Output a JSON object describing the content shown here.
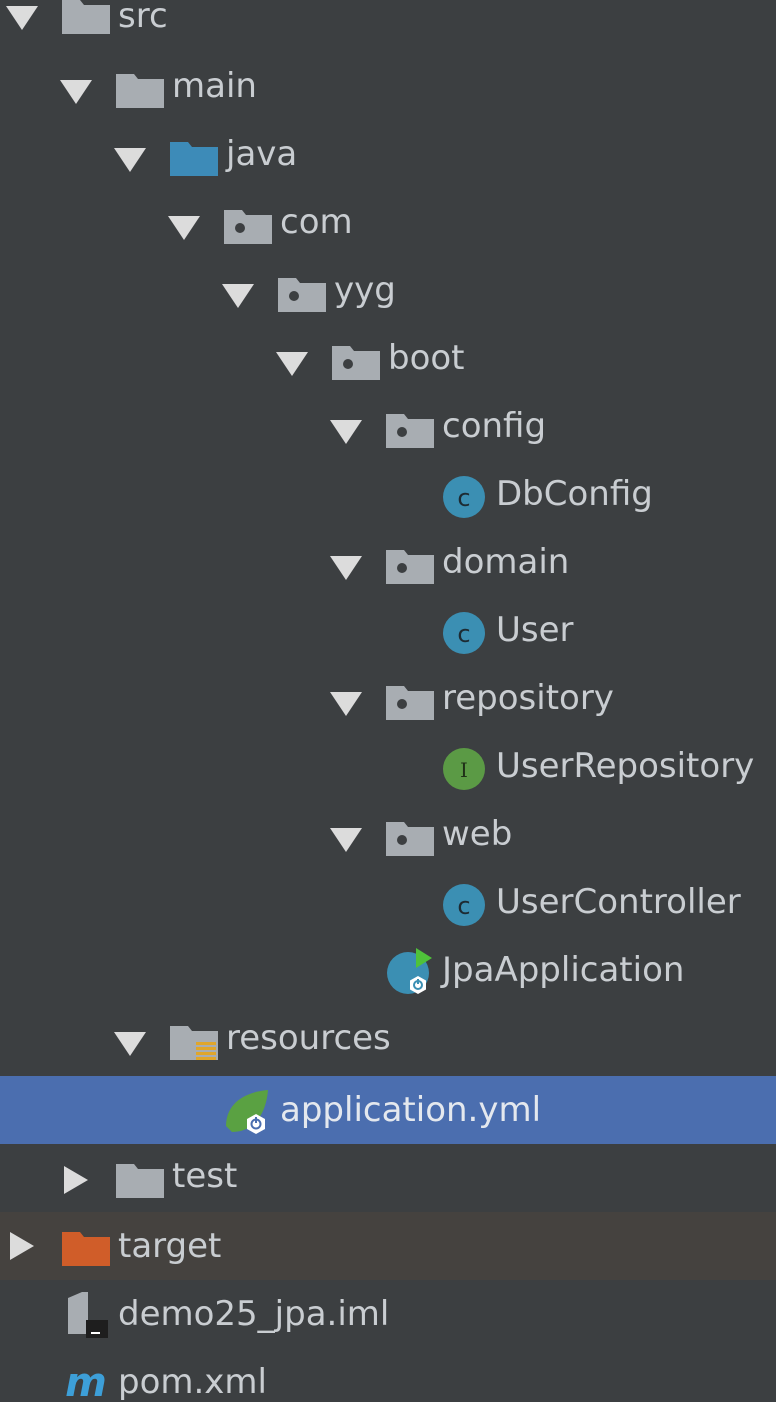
{
  "project_tree": {
    "items": [
      {
        "label": "src",
        "icon": "folder-icon",
        "expanded": true
      },
      {
        "label": "main",
        "icon": "folder-icon",
        "expanded": true
      },
      {
        "label": "java",
        "icon": "source-root-folder-icon",
        "expanded": true
      },
      {
        "label": "com",
        "icon": "package-icon",
        "expanded": true
      },
      {
        "label": "yyg",
        "icon": "package-icon",
        "expanded": true
      },
      {
        "label": "boot",
        "icon": "package-icon",
        "expanded": true
      },
      {
        "label": "config",
        "icon": "package-icon",
        "expanded": true
      },
      {
        "label": "DbConfig",
        "icon": "class-icon"
      },
      {
        "label": "domain",
        "icon": "package-icon",
        "expanded": true
      },
      {
        "label": "User",
        "icon": "class-icon"
      },
      {
        "label": "repository",
        "icon": "package-icon",
        "expanded": true
      },
      {
        "label": "UserRepository",
        "icon": "interface-icon"
      },
      {
        "label": "web",
        "icon": "package-icon",
        "expanded": true
      },
      {
        "label": "UserController",
        "icon": "class-icon"
      },
      {
        "label": "JpaApplication",
        "icon": "spring-boot-application-icon"
      },
      {
        "label": "resources",
        "icon": "resources-root-folder-icon",
        "expanded": true
      },
      {
        "label": "application.yml",
        "icon": "spring-boot-yml-icon",
        "selected": true
      },
      {
        "label": "test",
        "icon": "folder-icon",
        "expanded": false
      },
      {
        "label": "target",
        "icon": "excluded-folder-icon",
        "expanded": false
      },
      {
        "label": "demo25_jpa.iml",
        "icon": "iml-file-icon"
      },
      {
        "label": "pom.xml",
        "icon": "maven-icon"
      }
    ]
  },
  "colors": {
    "background": "#3c3f41",
    "selection": "#4b6eaf",
    "excluded_row": "#45423f",
    "folder": "#a8adb2",
    "source_root": "#3d8bb8",
    "excluded_folder": "#d05d29",
    "class": "#3b8fb3",
    "interface": "#5b9a45",
    "spring": "#5aa142"
  }
}
